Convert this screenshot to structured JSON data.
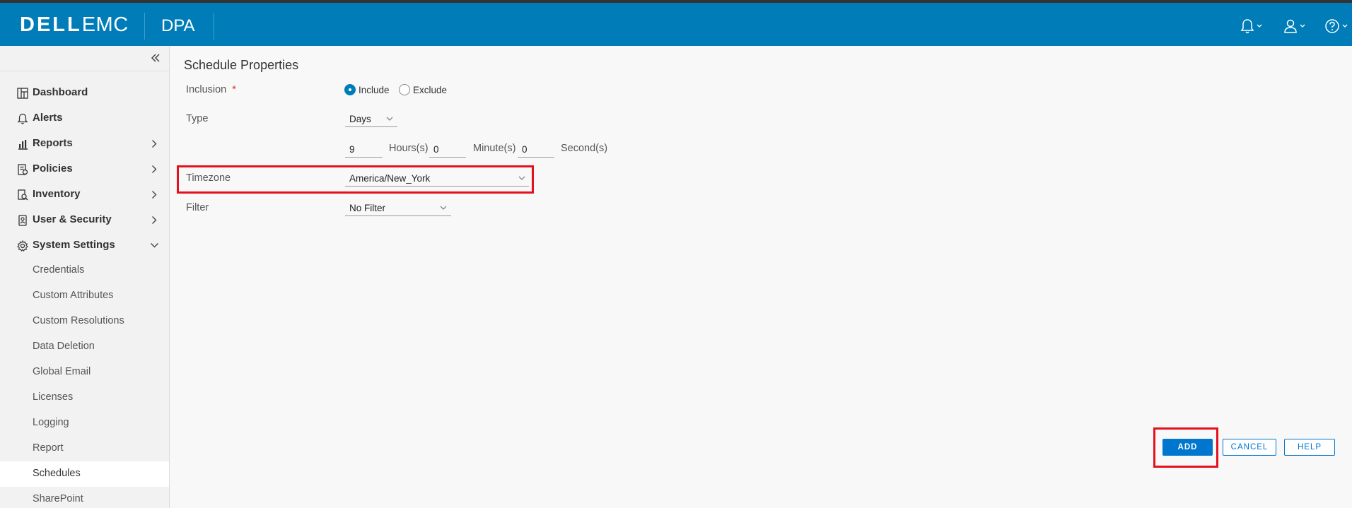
{
  "header": {
    "logo_bold": "DELL",
    "logo_light": "EMC",
    "product": "DPA"
  },
  "sidebar": {
    "items": [
      {
        "label": "Dashboard"
      },
      {
        "label": "Alerts"
      },
      {
        "label": "Reports"
      },
      {
        "label": "Policies"
      },
      {
        "label": "Inventory"
      },
      {
        "label": "User & Security"
      },
      {
        "label": "System Settings"
      }
    ],
    "sub_items": [
      {
        "label": "Credentials"
      },
      {
        "label": "Custom Attributes"
      },
      {
        "label": "Custom Resolutions"
      },
      {
        "label": "Data Deletion"
      },
      {
        "label": "Global Email"
      },
      {
        "label": "Licenses"
      },
      {
        "label": "Logging"
      },
      {
        "label": "Report"
      },
      {
        "label": "Schedules"
      },
      {
        "label": "SharePoint"
      }
    ],
    "active_sub_item": "Schedules"
  },
  "form": {
    "title": "Schedule Properties",
    "inclusion_label": "Inclusion",
    "required_mark": "*",
    "include_label": "Include",
    "exclude_label": "Exclude",
    "inclusion_value": "Include",
    "type_label": "Type",
    "type_value": "Days",
    "hours_value": "9",
    "hours_unit": "Hours(s)",
    "minutes_value": "0",
    "minutes_unit": "Minute(s)",
    "seconds_value": "0",
    "seconds_unit": "Second(s)",
    "timezone_label": "Timezone",
    "timezone_value": "America/New_York",
    "filter_label": "Filter",
    "filter_value": "No Filter"
  },
  "actions": {
    "add": "ADD",
    "cancel": "CANCEL",
    "help": "HELP"
  },
  "colors": {
    "header": "#007db8",
    "primary_button": "#0076ce",
    "highlight": "#e3101e"
  }
}
